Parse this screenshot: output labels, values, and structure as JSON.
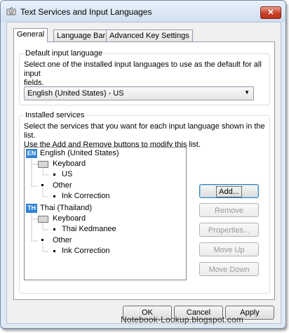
{
  "window": {
    "title": "Text Services and Input Languages",
    "close_label": "✕"
  },
  "tabs": [
    {
      "label": "General",
      "active": true
    },
    {
      "label": "Language Bar",
      "active": false
    },
    {
      "label": "Advanced Key Settings",
      "active": false
    }
  ],
  "default_input": {
    "legend": "Default input language",
    "description_line1": "Select one of the installed input languages to use as the default for all input",
    "description_line2": "fields.",
    "selected": "English (United States) - US"
  },
  "installed_services": {
    "legend": "Installed services",
    "description_line1": "Select the services that you want for each input language shown in the list.",
    "description_line2": "Use the Add and Remove buttons to modify this list.",
    "tree": {
      "english": {
        "badge": "EN",
        "label": "English (United States)",
        "keyboard": "Keyboard",
        "keyboard_item": "US",
        "other": "Other",
        "other_item": "Ink Correction"
      },
      "thai": {
        "badge": "TH",
        "label": "Thai (Thailand)",
        "keyboard": "Keyboard",
        "keyboard_item": "Thai Kedmanee",
        "other": "Other",
        "other_item": "Ink Correction"
      }
    },
    "buttons": {
      "add": "Add...",
      "remove": "Remove",
      "properties": "Properties...",
      "move_up": "Move Up",
      "move_down": "Move Down"
    }
  },
  "footer": {
    "ok": "OK",
    "cancel": "Cancel",
    "apply": "Apply"
  },
  "watermark": "Notebook-Lookup.blogspot.com",
  "colors": {
    "lang_badge": "#2f82d6",
    "close_button": "#c8402a",
    "window_frame": "#dfe9f5"
  }
}
